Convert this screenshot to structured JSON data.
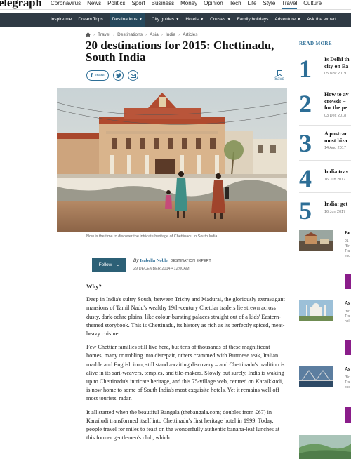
{
  "site": {
    "logo": "elegraph"
  },
  "topnav": [
    "Coronavirus",
    "News",
    "Politics",
    "Sport",
    "Business",
    "Money",
    "Opinion",
    "Tech",
    "Life",
    "Style",
    "Travel",
    "Culture"
  ],
  "subnav": [
    {
      "label": "Inspire me",
      "dropdown": false
    },
    {
      "label": "Dream Trips",
      "dropdown": false
    },
    {
      "label": "Destinations",
      "dropdown": true
    },
    {
      "label": "City guides",
      "dropdown": true
    },
    {
      "label": "Hotels",
      "dropdown": true
    },
    {
      "label": "Cruises",
      "dropdown": true
    },
    {
      "label": "Family holidays",
      "dropdown": false
    },
    {
      "label": "Adventure",
      "dropdown": true
    },
    {
      "label": "Ask the expert",
      "dropdown": false
    }
  ],
  "breadcrumb": [
    "Travel",
    "Destinations",
    "Asia",
    "India",
    "Articles"
  ],
  "article": {
    "title": "20 destinations for 2015: Chettinadu, South India",
    "share_label": "Share",
    "save_label": "Save",
    "caption": "Now is the time to discover the intricate heritage of Chettinadu in South India",
    "follow_label": "Follow",
    "by": "By",
    "author": "Isabella Noble",
    "author_role": "destination expert",
    "date": "29 DECEMBER 2014 • 12:00AM",
    "heading": "Why?",
    "p1": "Deep in India's sultry South, between Trichy and Madurai, the gloriously extravagant mansions of Tamil Nadu's wealthy 19th-century Chettiar traders lie strewn across dusty, dark-ochre plains, like colour-bursting palaces straight out of a kids' Eastern-themed storybook. This is Chettinadu, its history as rich as its perfectly spiced, meat-heavy cuisine.",
    "p2": "Few Chettiar families still live here, but tens of thousands of these magnificent homes, many crumbling into disrepair, others crammed with Burmese teak, Italian marble and English iron, still stand awaiting discovery – and Chettinadu's tradition is alive in its sari-weavers, temples, and tile-makers. Slowly but surely, India is waking up to Chettinadu's intricate heritage, and this 75-village web, centred on Karaikkudi, is now home to some of South India's most exquisite hotels. Yet it remains well off most tourists' radar.",
    "p3_before": "It all started when the beautiful Bangala (",
    "p3_link": "thebangala.com",
    "p3_after": "; doubles from £67) in Karailudi transformed itself into Chettinadu's first heritage hotel in 1999. Today, people travel for miles to feast on the wonderfully authentic banana-leaf lunches at this former gentlemen's club, which"
  },
  "sidebar": {
    "heading": "READ MORE",
    "items": [
      {
        "num": "1",
        "lines": [
          "Is Delhi th",
          "city on Ea"
        ],
        "date": "05 Nov 2019"
      },
      {
        "num": "2",
        "lines": [
          "How to av",
          "crowds –",
          "for the pe"
        ],
        "date": "03 Dec 2018"
      },
      {
        "num": "3",
        "lines": [
          "A postcar",
          "most biza"
        ],
        "date": "14 Aug 2017"
      },
      {
        "num": "4",
        "lines": [
          "India trav"
        ],
        "date": "16 Jun 2017"
      },
      {
        "num": "5",
        "lines": [
          "India: get"
        ],
        "date": "16 Jun 2017"
      }
    ],
    "cards": [
      {
        "title": "Be",
        "lines": [
          "01",
          "\"Br",
          "Tra",
          "esc"
        ]
      },
      {
        "title": "As",
        "lines": [
          "\"Br",
          "Tra",
          "hol"
        ]
      },
      {
        "title": "As",
        "lines": [
          "\"Br",
          "Tra",
          "occ"
        ]
      }
    ]
  }
}
